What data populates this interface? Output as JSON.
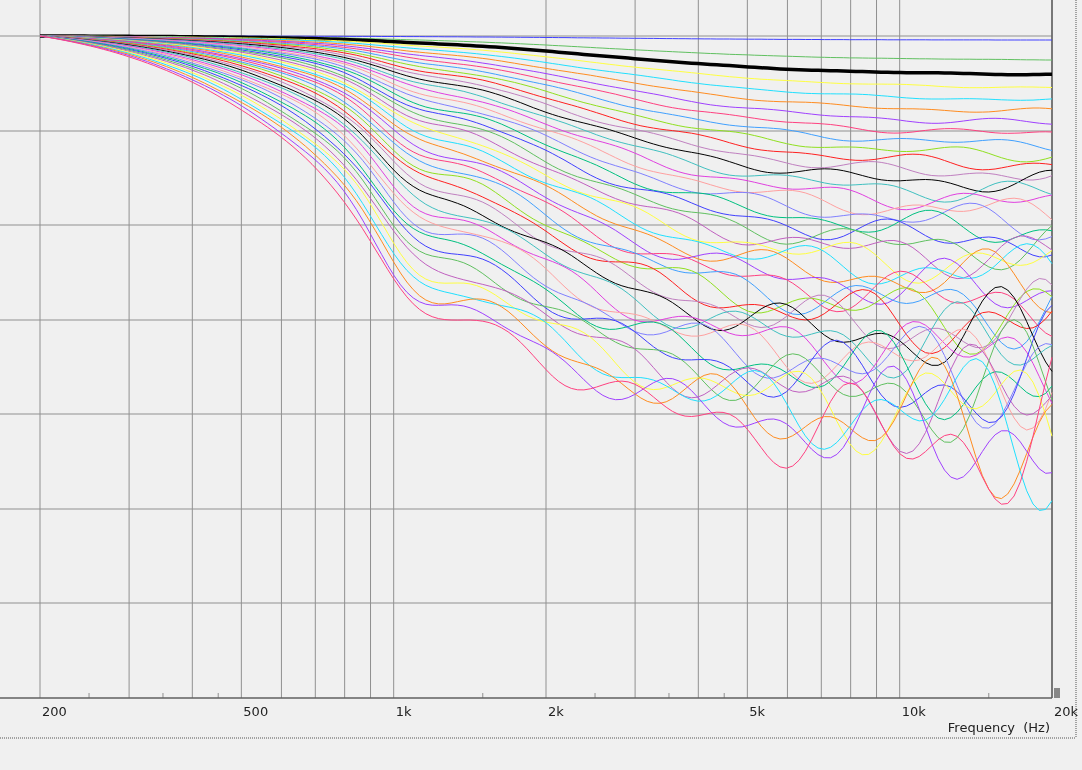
{
  "x_axis": {
    "tick_labels": [
      "200",
      "500",
      "1k",
      "2k",
      "5k",
      "10k",
      "20k"
    ],
    "title": "Frequency  (Hz)"
  }
}
